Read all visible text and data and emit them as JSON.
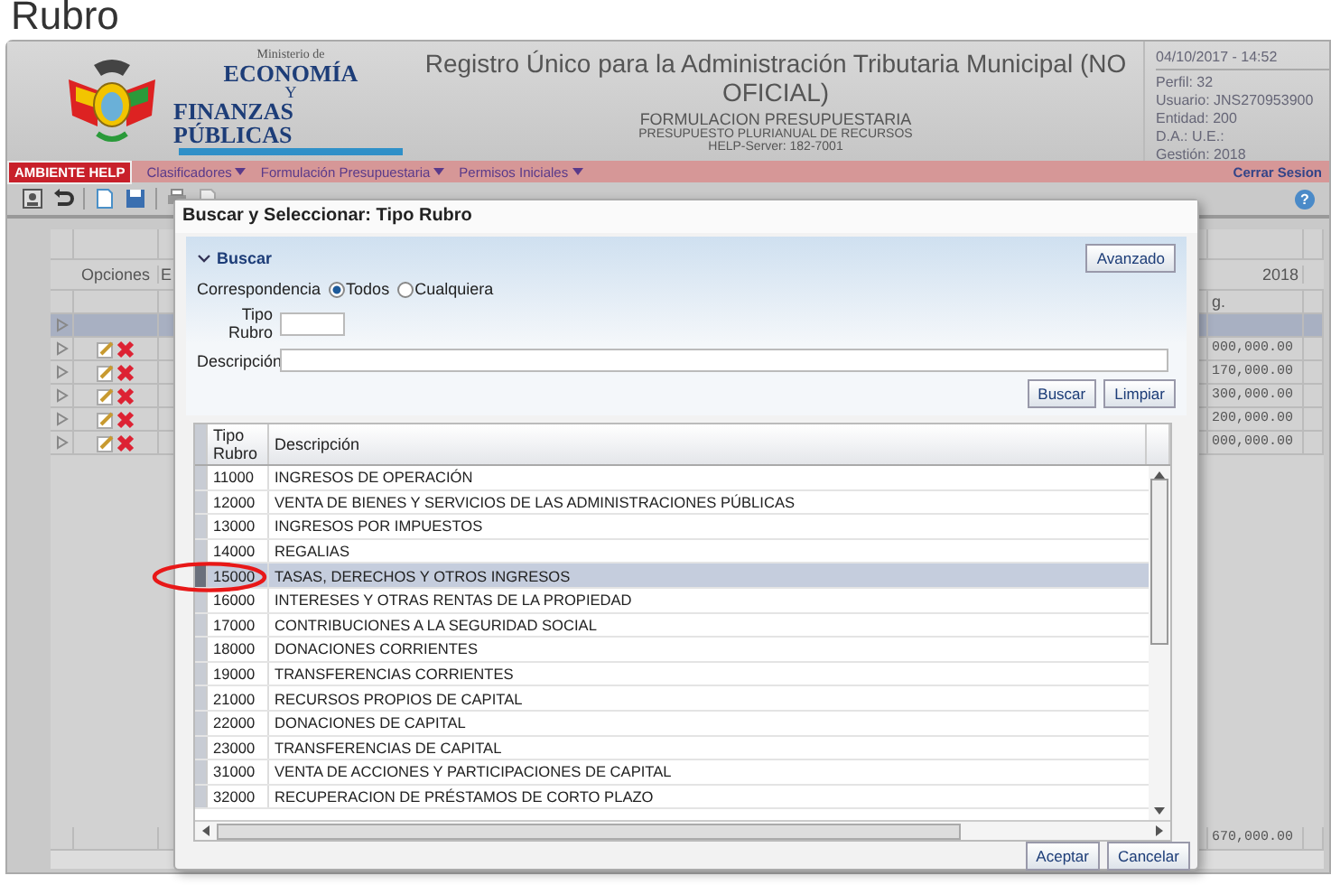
{
  "page_heading": "Rubro",
  "header": {
    "ministry_small": "Ministerio de",
    "ministry_line1": "ECONOMÍA",
    "ministry_y": "Y",
    "ministry_line2": "FINANZAS PÚBLICAS",
    "title": "Registro Único para la Administración Tributaria Municipal (NO OFICIAL)",
    "subtitle": "FORMULACION PRESUPUESTARIA",
    "subtitle2": "PRESUPUESTO PLURIANUAL DE RECURSOS",
    "server": "HELP-Server: 182-7001"
  },
  "session": {
    "datetime": "04/10/2017 - 14:52",
    "lines": [
      "Perfil: 32",
      "Usuario: JNS270953900",
      "Entidad: 200",
      "D.A.:   U.E.:",
      "Gestión: 2018"
    ]
  },
  "menu": {
    "environment": "AMBIENTE HELP",
    "items": [
      "Clasificadores",
      "Formulación Presupuestaria",
      "Permisos Iniciales"
    ],
    "logout": "Cerrar Sesion",
    "help": "?"
  },
  "background_table": {
    "options_header": "Opciones",
    "column_2_header": "E",
    "year": "2018",
    "amount_header": "g.",
    "total": "670,000.00",
    "rows": [
      {
        "selected": true
      },
      {
        "selected": false,
        "amount": "000,000.00"
      },
      {
        "selected": false,
        "amount": "170,000.00"
      },
      {
        "selected": false,
        "amount": "300,000.00"
      },
      {
        "selected": false,
        "amount": "200,000.00"
      },
      {
        "selected": false,
        "amount": "000,000.00"
      }
    ]
  },
  "dialog": {
    "title": "Buscar y Seleccionar: Tipo Rubro",
    "section": {
      "label": "Buscar",
      "expanded": true
    },
    "advanced_button": "Avanzado",
    "match": {
      "label": "Correspondencia",
      "options": [
        {
          "label": "Todos",
          "selected": true
        },
        {
          "label": "Cualquiera",
          "selected": false
        }
      ]
    },
    "fields": [
      {
        "label": "Tipo Rubro",
        "kind": "short"
      },
      {
        "label": "Descripción",
        "kind": "wide"
      }
    ],
    "search_buttons": [
      "Buscar",
      "Limpiar"
    ],
    "columns": [
      "Tipo Rubro",
      "Descripción"
    ],
    "rows": [
      {
        "code": "11000",
        "description": "INGRESOS DE OPERACIÓN",
        "selected": false
      },
      {
        "code": "12000",
        "description": "VENTA DE BIENES Y SERVICIOS DE LAS ADMINISTRACIONES PÚBLICAS",
        "selected": false
      },
      {
        "code": "13000",
        "description": "INGRESOS POR IMPUESTOS",
        "selected": false
      },
      {
        "code": "14000",
        "description": "REGALIAS",
        "selected": false
      },
      {
        "code": "15000",
        "description": "TASAS, DERECHOS Y OTROS INGRESOS",
        "selected": true
      },
      {
        "code": "16000",
        "description": "INTERESES Y OTRAS RENTAS DE LA PROPIEDAD",
        "selected": false
      },
      {
        "code": "17000",
        "description": "CONTRIBUCIONES A LA SEGURIDAD SOCIAL",
        "selected": false
      },
      {
        "code": "18000",
        "description": "DONACIONES CORRIENTES",
        "selected": false
      },
      {
        "code": "19000",
        "description": "TRANSFERENCIAS CORRIENTES",
        "selected": false
      },
      {
        "code": "21000",
        "description": "RECURSOS PROPIOS DE CAPITAL",
        "selected": false
      },
      {
        "code": "22000",
        "description": "DONACIONES DE CAPITAL",
        "selected": false
      },
      {
        "code": "23000",
        "description": "TRANSFERENCIAS DE CAPITAL",
        "selected": false
      },
      {
        "code": "31000",
        "description": "VENTA DE ACCIONES Y PARTICIPACIONES DE CAPITAL",
        "selected": false
      },
      {
        "code": "32000",
        "description": "RECUPERACION DE PRÉSTAMOS DE CORTO PLAZO",
        "selected": false
      }
    ],
    "footer_buttons": [
      "Aceptar",
      "Cancelar"
    ]
  }
}
